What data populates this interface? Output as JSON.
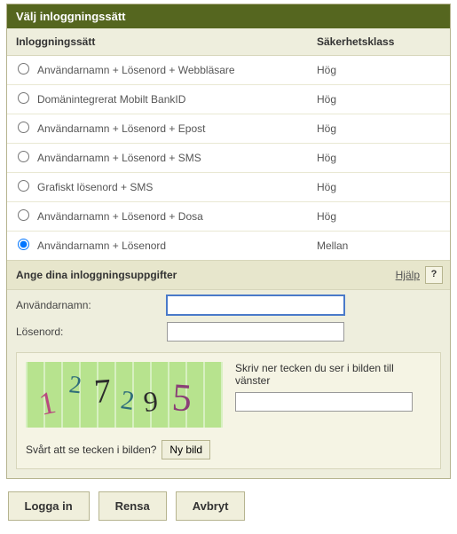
{
  "panel_title": "Välj inloggningssätt",
  "columns": {
    "method": "Inloggningssätt",
    "security": "Säkerhetsklass"
  },
  "options": [
    {
      "label": "Användarnamn + Lösenord + Webbläsare",
      "security": "Hög",
      "selected": false
    },
    {
      "label": "Domänintegrerat Mobilt BankID",
      "security": "Hög",
      "selected": false
    },
    {
      "label": "Användarnamn + Lösenord + Epost",
      "security": "Hög",
      "selected": false
    },
    {
      "label": "Användarnamn + Lösenord + SMS",
      "security": "Hög",
      "selected": false
    },
    {
      "label": "Grafiskt lösenord + SMS",
      "security": "Hög",
      "selected": false
    },
    {
      "label": "Användarnamn + Lösenord + Dosa",
      "security": "Hög",
      "selected": false
    },
    {
      "label": "Användarnamn + Lösenord",
      "security": "Mellan",
      "selected": true
    }
  ],
  "credentials": {
    "title": "Ange dina inloggningsuppgifter",
    "help_label": "Hjälp",
    "help_button": "?",
    "username_label": "Användarnamn:",
    "password_label": "Lösenord:",
    "username_value": "",
    "password_value": ""
  },
  "captcha": {
    "text": "127295",
    "instruction": "Skriv ner tecken du ser i bilden till vänster",
    "input_value": "",
    "trouble_label": "Svårt att se tecken i bilden?",
    "new_image_button": "Ny bild"
  },
  "buttons": {
    "login": "Logga in",
    "reset": "Rensa",
    "cancel": "Avbryt"
  }
}
